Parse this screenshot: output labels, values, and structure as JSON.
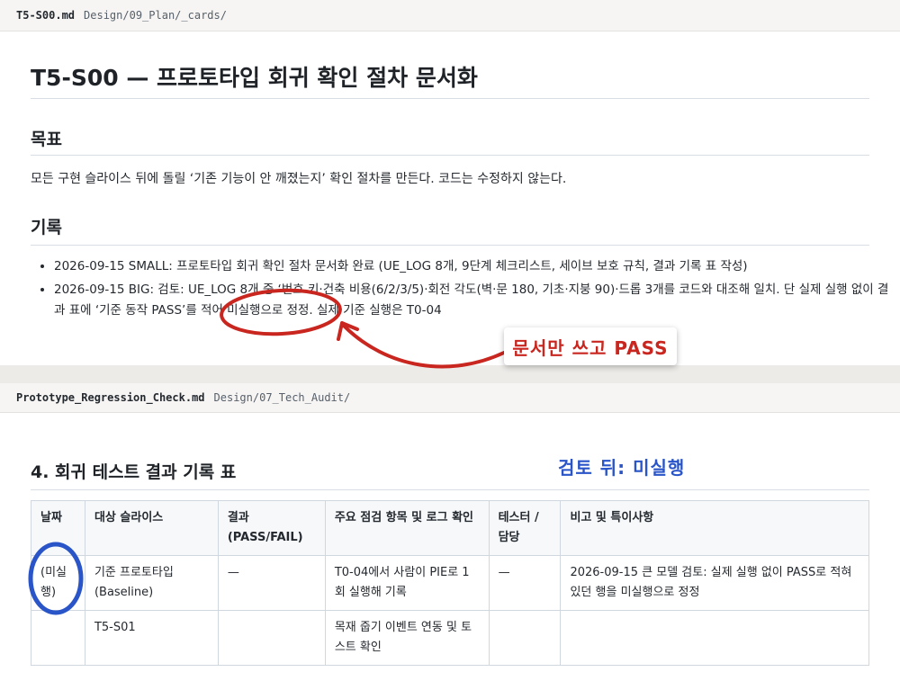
{
  "file1": {
    "name": "T5-S00.md",
    "path": "Design/09_Plan/_cards/"
  },
  "doc1": {
    "title": "T5-S00 — 프로토타입 회귀 확인 절차 문서화",
    "goal_heading": "목표",
    "goal_text": "모든 구현 슬라이스 뒤에 돌릴 ‘기존 기능이 안 깨졌는지’ 확인 절차를 만든다. 코드는 수정하지 않는다.",
    "log_heading": "기록",
    "log_items": [
      "2026-09-15 SMALL: 프로토타입 회귀 확인 절차 문서화 완료 (UE_LOG 8개, 9단계 체크리스트, 세이브 보호 규칙, 결과 기록 표 작성)",
      "2026-09-15 BIG: 검토: UE_LOG 8개 중 ‘번호 키·건축 비용(6/2/3/5)·회전 각도(벽·문 180, 기초·지붕 90)·드롭 3개를 코드와 대조해 일치. 단 실제 실행 없이 결과 표에 ‘기준 동작 PASS’를 적어 미실행으로 정정. 실제 기준 실행은 T0-04"
    ]
  },
  "file2": {
    "name": "Prototype_Regression_Check.md",
    "path": "Design/07_Tech_Audit/"
  },
  "doc2": {
    "section_title": "4. 회귀 테스트 결과 기록 표",
    "table": {
      "headers": [
        "날짜",
        "대상 슬라이스",
        "결과 (PASS/FAIL)",
        "주요 점검 항목 및 로그 확인",
        "테스터 / 담당",
        "비고 및 특이사항"
      ],
      "rows": [
        [
          "(미실행)",
          "기준 프로토타입 (Baseline)",
          "—",
          "T0-04에서 사람이 PIE로 1회 실행해 기록",
          "—",
          "2026-09-15 큰 모델 검토: 실제 실행 없이 PASS로 적혀 있던 행을 미실행으로 정정"
        ],
        [
          "",
          "T5-S01",
          "",
          "목재 줍기 이벤트 연동 및 토스트 확인",
          "",
          ""
        ]
      ]
    }
  },
  "annotations": {
    "callout": "문서만 쓰고 PASS",
    "note": "검토 뒤: 미실행",
    "red": "#c8261f",
    "blue": "#2a55c8"
  }
}
